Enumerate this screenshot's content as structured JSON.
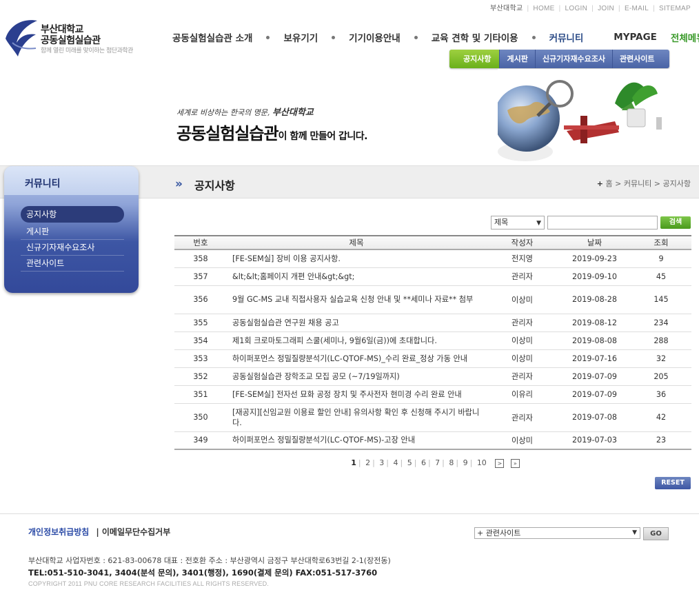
{
  "util_links": {
    "university": "부산대학교",
    "home": "HOME",
    "login": "LOGIN",
    "join": "JOIN",
    "email": "E-MAIL",
    "sitemap": "SITEMAP"
  },
  "logo": {
    "line1": "부산대학교",
    "line2": "공동실험실습관",
    "tagline": "함께 열린 미래를 맞이하는 첨단과학관"
  },
  "gnb": {
    "items": [
      "공동실험실습관 소개",
      "보유기기",
      "기기이용안내",
      "교육 견학 및 기타이용",
      "커뮤니티",
      "MYPAGE",
      "전체메뉴"
    ]
  },
  "subnav": {
    "items": [
      "공지사항",
      "게시판",
      "신규기자재수요조사",
      "관련사이트"
    ]
  },
  "visual": {
    "slogan_small": "세계로 비상하는 한국의 명문,",
    "slogan_univ": "부산대학교",
    "slogan_big": "공동실험실습관",
    "slogan_rest": "이 함께 만들어 갑니다."
  },
  "lnb": {
    "title": "커뮤니티",
    "items": [
      "공지사항",
      "게시판",
      "신규기자재수요조사",
      "관련사이트"
    ]
  },
  "page": {
    "title": "공지사항",
    "breadcrumb_plus": "+",
    "breadcrumb": "홈 > 커뮤니티 > 공지사항"
  },
  "search": {
    "field": "제목",
    "button": "검색"
  },
  "table": {
    "headers": [
      "번호",
      "제목",
      "작성자",
      "날짜",
      "조회"
    ],
    "rows": [
      {
        "no": "358",
        "title": "[FE-SEM실] 장비 이용 공지사항.",
        "author": "전지영",
        "date": "2019-09-23",
        "views": "9"
      },
      {
        "no": "357",
        "title": "&lt;&lt;홈페이지 개편 안내&gt;&gt;",
        "author": "관리자",
        "date": "2019-09-10",
        "views": "45"
      },
      {
        "no": "356",
        "title": "9월 GC-MS 교내 직접사용자 실습교육 신청 안내 및 **세미나 자료** 첨부",
        "author": "이상미",
        "date": "2019-08-28",
        "views": "145"
      },
      {
        "no": "355",
        "title": "공동실험실습관 연구원 채용 공고",
        "author": "관리자",
        "date": "2019-08-12",
        "views": "234"
      },
      {
        "no": "354",
        "title": "제1회 크로마토그래피 스쿨(세미나, 9월6일(금))에 초대합니다.",
        "author": "이상미",
        "date": "2019-08-08",
        "views": "288"
      },
      {
        "no": "353",
        "title": "하이퍼포먼스 정밀질량분석기(LC-QTOF-MS)_수리 완료_정상 가동 안내",
        "author": "이상미",
        "date": "2019-07-16",
        "views": "32"
      },
      {
        "no": "352",
        "title": "공동실험실습관 장학조교 모집 공모 (~7/19일까지)",
        "author": "관리자",
        "date": "2019-07-09",
        "views": "205"
      },
      {
        "no": "351",
        "title": "[FE-SEM실] 전자선 묘화 공정 장치 및 주사전자 현미경 수리 완료 안내",
        "author": "이유리",
        "date": "2019-07-09",
        "views": "36"
      },
      {
        "no": "350",
        "title": "[재공지][신임교원 이용료 할인 안내] 유의사항 확인 후 신청해 주시기 바랍니다.",
        "author": "관리자",
        "date": "2019-07-08",
        "views": "42"
      },
      {
        "no": "349",
        "title": "하이퍼포먼스 정밀질량분석기(LC-QTOF-MS)-고장 안내",
        "author": "이상미",
        "date": "2019-07-03",
        "views": "23"
      }
    ]
  },
  "pager": {
    "pages": [
      "1",
      "2",
      "3",
      "4",
      "5",
      "6",
      "7",
      "8",
      "9",
      "10"
    ],
    "current": "1",
    "next": ">",
    "last": "»"
  },
  "reset": {
    "label": "RESET"
  },
  "footer": {
    "privacy": "개인정보취급방침",
    "email_refuse": "| 이메일무단수집거부",
    "related_select": "+ 관련사이트",
    "go": "GO",
    "address": "부산대학교   사업자번호 : 621-83-00678   대표 : 전호환   주소 : 부산광역시 금정구 부산대학로63번길 2-1(장전동)",
    "tel": "TEL:051-510-3041, 3404(분석 문의), 3401(행정), 1690(결제 문의)   FAX:051-517-3760",
    "copyright": "COPYRIGHT 2011 PNU CORE RESEARCH FACILITIES ALL RIGHTS RESERVED."
  },
  "colors": {
    "brand_blue": "#3d56a4",
    "accent_green": "#6ab01a"
  }
}
